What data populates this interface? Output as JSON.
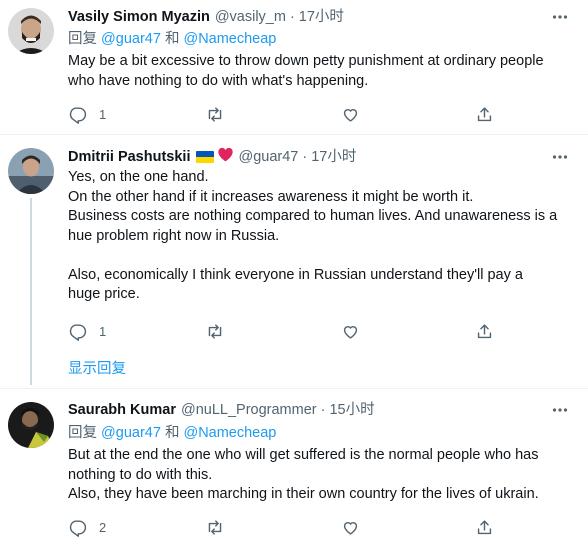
{
  "tweets": [
    {
      "name": "Vasily Simon Myazin",
      "handle": "@vasily_m",
      "dot": "·",
      "time": "17小时",
      "reply_prefix": "回复",
      "reply_mention_1": "@guar47",
      "reply_and": "和",
      "reply_mention_2": "@Namecheap",
      "lines": [
        "May be a bit excessive to throw down petty punishment at ordinary people",
        "who have nothing to do with what's happening."
      ],
      "reply_count": "1",
      "retweet_count": "",
      "like_count": ""
    },
    {
      "name": "Dmitrii Pashutskii",
      "handle": "@guar47",
      "dot": "·",
      "time": "17小时",
      "badges": [
        "ukraine-flag",
        "red-heart"
      ],
      "lines": [
        "Yes, on the one hand.",
        "On the other hand if it increases awareness it might be worth it.",
        "Business costs are nothing compared to human lives. And unawareness is a",
        "hue problem right now in Russia.",
        "",
        "Also, economically I think everyone in Russian understand they'll pay a",
        "huge price."
      ],
      "reply_count": "1",
      "retweet_count": "",
      "like_count": ""
    },
    {
      "name": "Saurabh Kumar",
      "handle": "@nuLL_Programmer",
      "dot": "·",
      "time": "15小时",
      "reply_prefix": "回复",
      "reply_mention_1": "@guar47",
      "reply_and": "和",
      "reply_mention_2": "@Namecheap",
      "lines": [
        "But at the end the one who will get suffered is the normal people who has",
        "nothing to do with this.",
        "Also, they have been marching in their own country for the lives of ukrain."
      ],
      "reply_count": "2",
      "retweet_count": "",
      "like_count": ""
    }
  ],
  "show_replies_label": "显示回复",
  "colors": {
    "text": "#0f1419",
    "secondary": "#536471",
    "accent": "#1d9bf0",
    "divider": "#eff3f4",
    "thread_line": "#cfd9de"
  },
  "icons": {
    "more": "more-icon",
    "reply": "reply-icon",
    "retweet": "retweet-icon",
    "like": "heart-icon",
    "share": "share-icon"
  }
}
